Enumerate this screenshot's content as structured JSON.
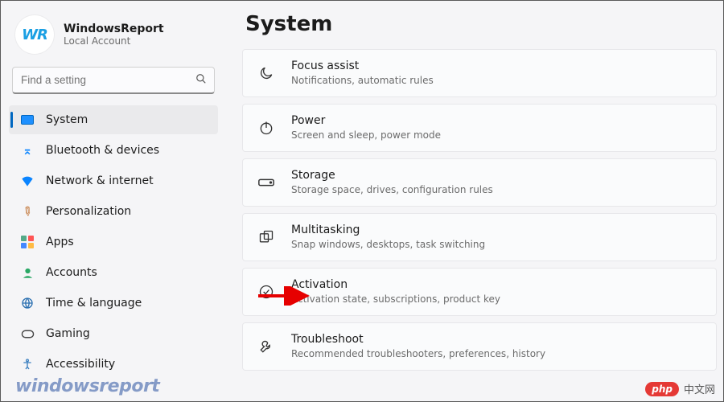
{
  "profile": {
    "name": "WindowsReport",
    "sub": "Local Account",
    "avatar_text": "WR"
  },
  "search": {
    "placeholder": "Find a setting"
  },
  "sidebar": {
    "items": [
      {
        "label": "System",
        "selected": true
      },
      {
        "label": "Bluetooth & devices"
      },
      {
        "label": "Network & internet"
      },
      {
        "label": "Personalization"
      },
      {
        "label": "Apps"
      },
      {
        "label": "Accounts"
      },
      {
        "label": "Time & language"
      },
      {
        "label": "Gaming"
      },
      {
        "label": "Accessibility"
      }
    ]
  },
  "page": {
    "title": "System"
  },
  "cards": [
    {
      "title": "Focus assist",
      "sub": "Notifications, automatic rules",
      "icon": "moon"
    },
    {
      "title": "Power",
      "sub": "Screen and sleep, power mode",
      "icon": "power"
    },
    {
      "title": "Storage",
      "sub": "Storage space, drives, configuration rules",
      "icon": "drive"
    },
    {
      "title": "Multitasking",
      "sub": "Snap windows, desktops, task switching",
      "icon": "multi"
    },
    {
      "title": "Activation",
      "sub": "Activation state, subscriptions, product key",
      "icon": "check"
    },
    {
      "title": "Troubleshoot",
      "sub": "Recommended troubleshooters, preferences, history",
      "icon": "wrench"
    }
  ],
  "watermarks": {
    "left": "windowsreport",
    "right_pill": "php",
    "right_text": "中文网"
  }
}
